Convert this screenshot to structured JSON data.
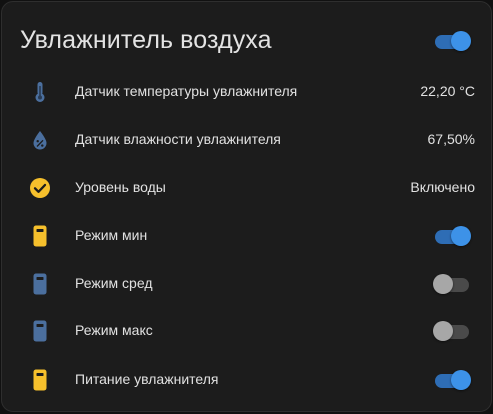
{
  "card": {
    "title": "Увлажнитель воздуха",
    "master_toggle": "on"
  },
  "colors": {
    "accent": "#3d92e8",
    "icon_blue": "#4b6f9e",
    "icon_yellow": "#f6c02c",
    "background": "#1c1c1c",
    "text": "#e1e1e1"
  },
  "rows": [
    {
      "label": "Датчик температуры увлажнителя",
      "value": "22,20 °C",
      "icon": "thermometer-icon",
      "icon_color": "blue"
    },
    {
      "label": "Датчик влажности увлажнителя",
      "value": "67,50%",
      "icon": "water-percent-icon",
      "icon_color": "blue"
    },
    {
      "label": "Уровень воды",
      "value": "Включено",
      "icon": "check-circle-icon",
      "icon_color": "yellow"
    },
    {
      "label": "Режим мин",
      "toggle": "on",
      "icon": "device-icon",
      "icon_color": "yellow"
    },
    {
      "label": "Режим сред",
      "toggle": "off",
      "icon": "device-icon",
      "icon_color": "blue"
    },
    {
      "label": "Режим макс",
      "toggle": "off",
      "icon": "device-icon",
      "icon_color": "blue"
    },
    {
      "label": "Питание увлажнителя",
      "toggle": "on",
      "icon": "device-icon",
      "icon_color": "yellow"
    }
  ]
}
